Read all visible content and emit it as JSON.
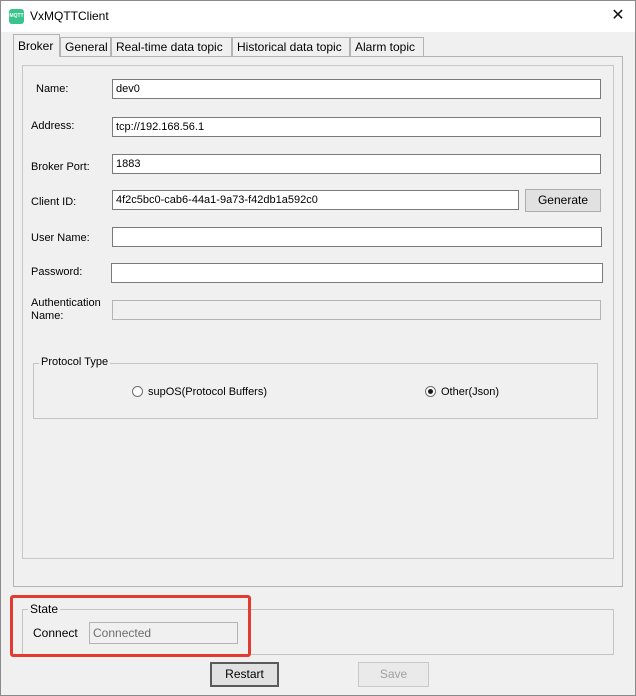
{
  "window": {
    "title": "VxMQTTClient",
    "app_icon_text": "MQTT",
    "close_glyph": "✕"
  },
  "tabs": [
    {
      "label": "Broker",
      "active": true
    },
    {
      "label": "General",
      "active": false
    },
    {
      "label": "Real-time data topic",
      "active": false
    },
    {
      "label": "Historical data topic",
      "active": false
    },
    {
      "label": "Alarm topic",
      "active": false
    }
  ],
  "form": {
    "name": {
      "label": "Name:",
      "value": "dev0"
    },
    "address": {
      "label": "Address:",
      "value": "tcp://192.168.56.1"
    },
    "broker_port": {
      "label": "Broker Port:",
      "value": "1883"
    },
    "client_id": {
      "label": "Client ID:",
      "value": "4f2c5bc0-cab6-44a1-9a73-f42db1a592c0"
    },
    "generate_button": "Generate",
    "user_name": {
      "label": "User Name:",
      "value": ""
    },
    "password": {
      "label": "Password:",
      "value": ""
    },
    "auth_name": {
      "label_line1": "Authentication",
      "label_line2": "Name:",
      "value": ""
    }
  },
  "protocol": {
    "title": "Protocol Type",
    "options": [
      {
        "label": "supOS(Protocol Buffers)",
        "checked": false
      },
      {
        "label": "Other(Json)",
        "checked": true
      }
    ]
  },
  "state": {
    "title": "State",
    "connect_label": "Connect",
    "connect_value": "Connected"
  },
  "buttons": {
    "restart": "Restart",
    "save": "Save"
  },
  "colors": {
    "highlight": "#e23c32",
    "app_icon": "#39c48e"
  }
}
